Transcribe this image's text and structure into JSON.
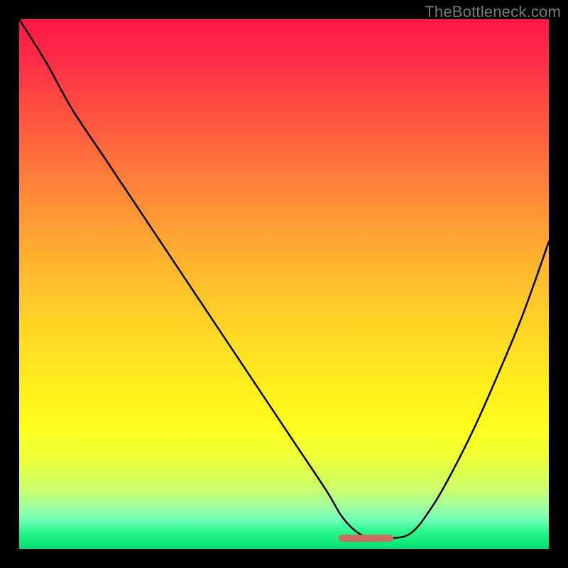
{
  "watermark": "TheBottleneck.com",
  "chart_data": {
    "type": "line",
    "title": "",
    "xlabel": "",
    "ylabel": "",
    "xlim": [
      0,
      100
    ],
    "ylim": [
      0,
      100
    ],
    "series": [
      {
        "name": "bottleneck-curve",
        "x": [
          0,
          5,
          10,
          16,
          22,
          28,
          34,
          40,
          46,
          52,
          58,
          61,
          64,
          67,
          70,
          74,
          78,
          82,
          86,
          90,
          95,
          100
        ],
        "y": [
          100,
          92,
          83,
          74,
          65,
          56,
          47,
          38,
          29,
          20,
          11,
          6,
          3,
          2,
          2,
          3,
          8,
          15,
          23,
          32,
          44,
          58
        ]
      },
      {
        "name": "flat-minimum-marker",
        "x": [
          61,
          70
        ],
        "y": [
          2,
          2
        ]
      }
    ]
  },
  "colors": {
    "curve": "#000000",
    "marker": "#cc6b60"
  }
}
